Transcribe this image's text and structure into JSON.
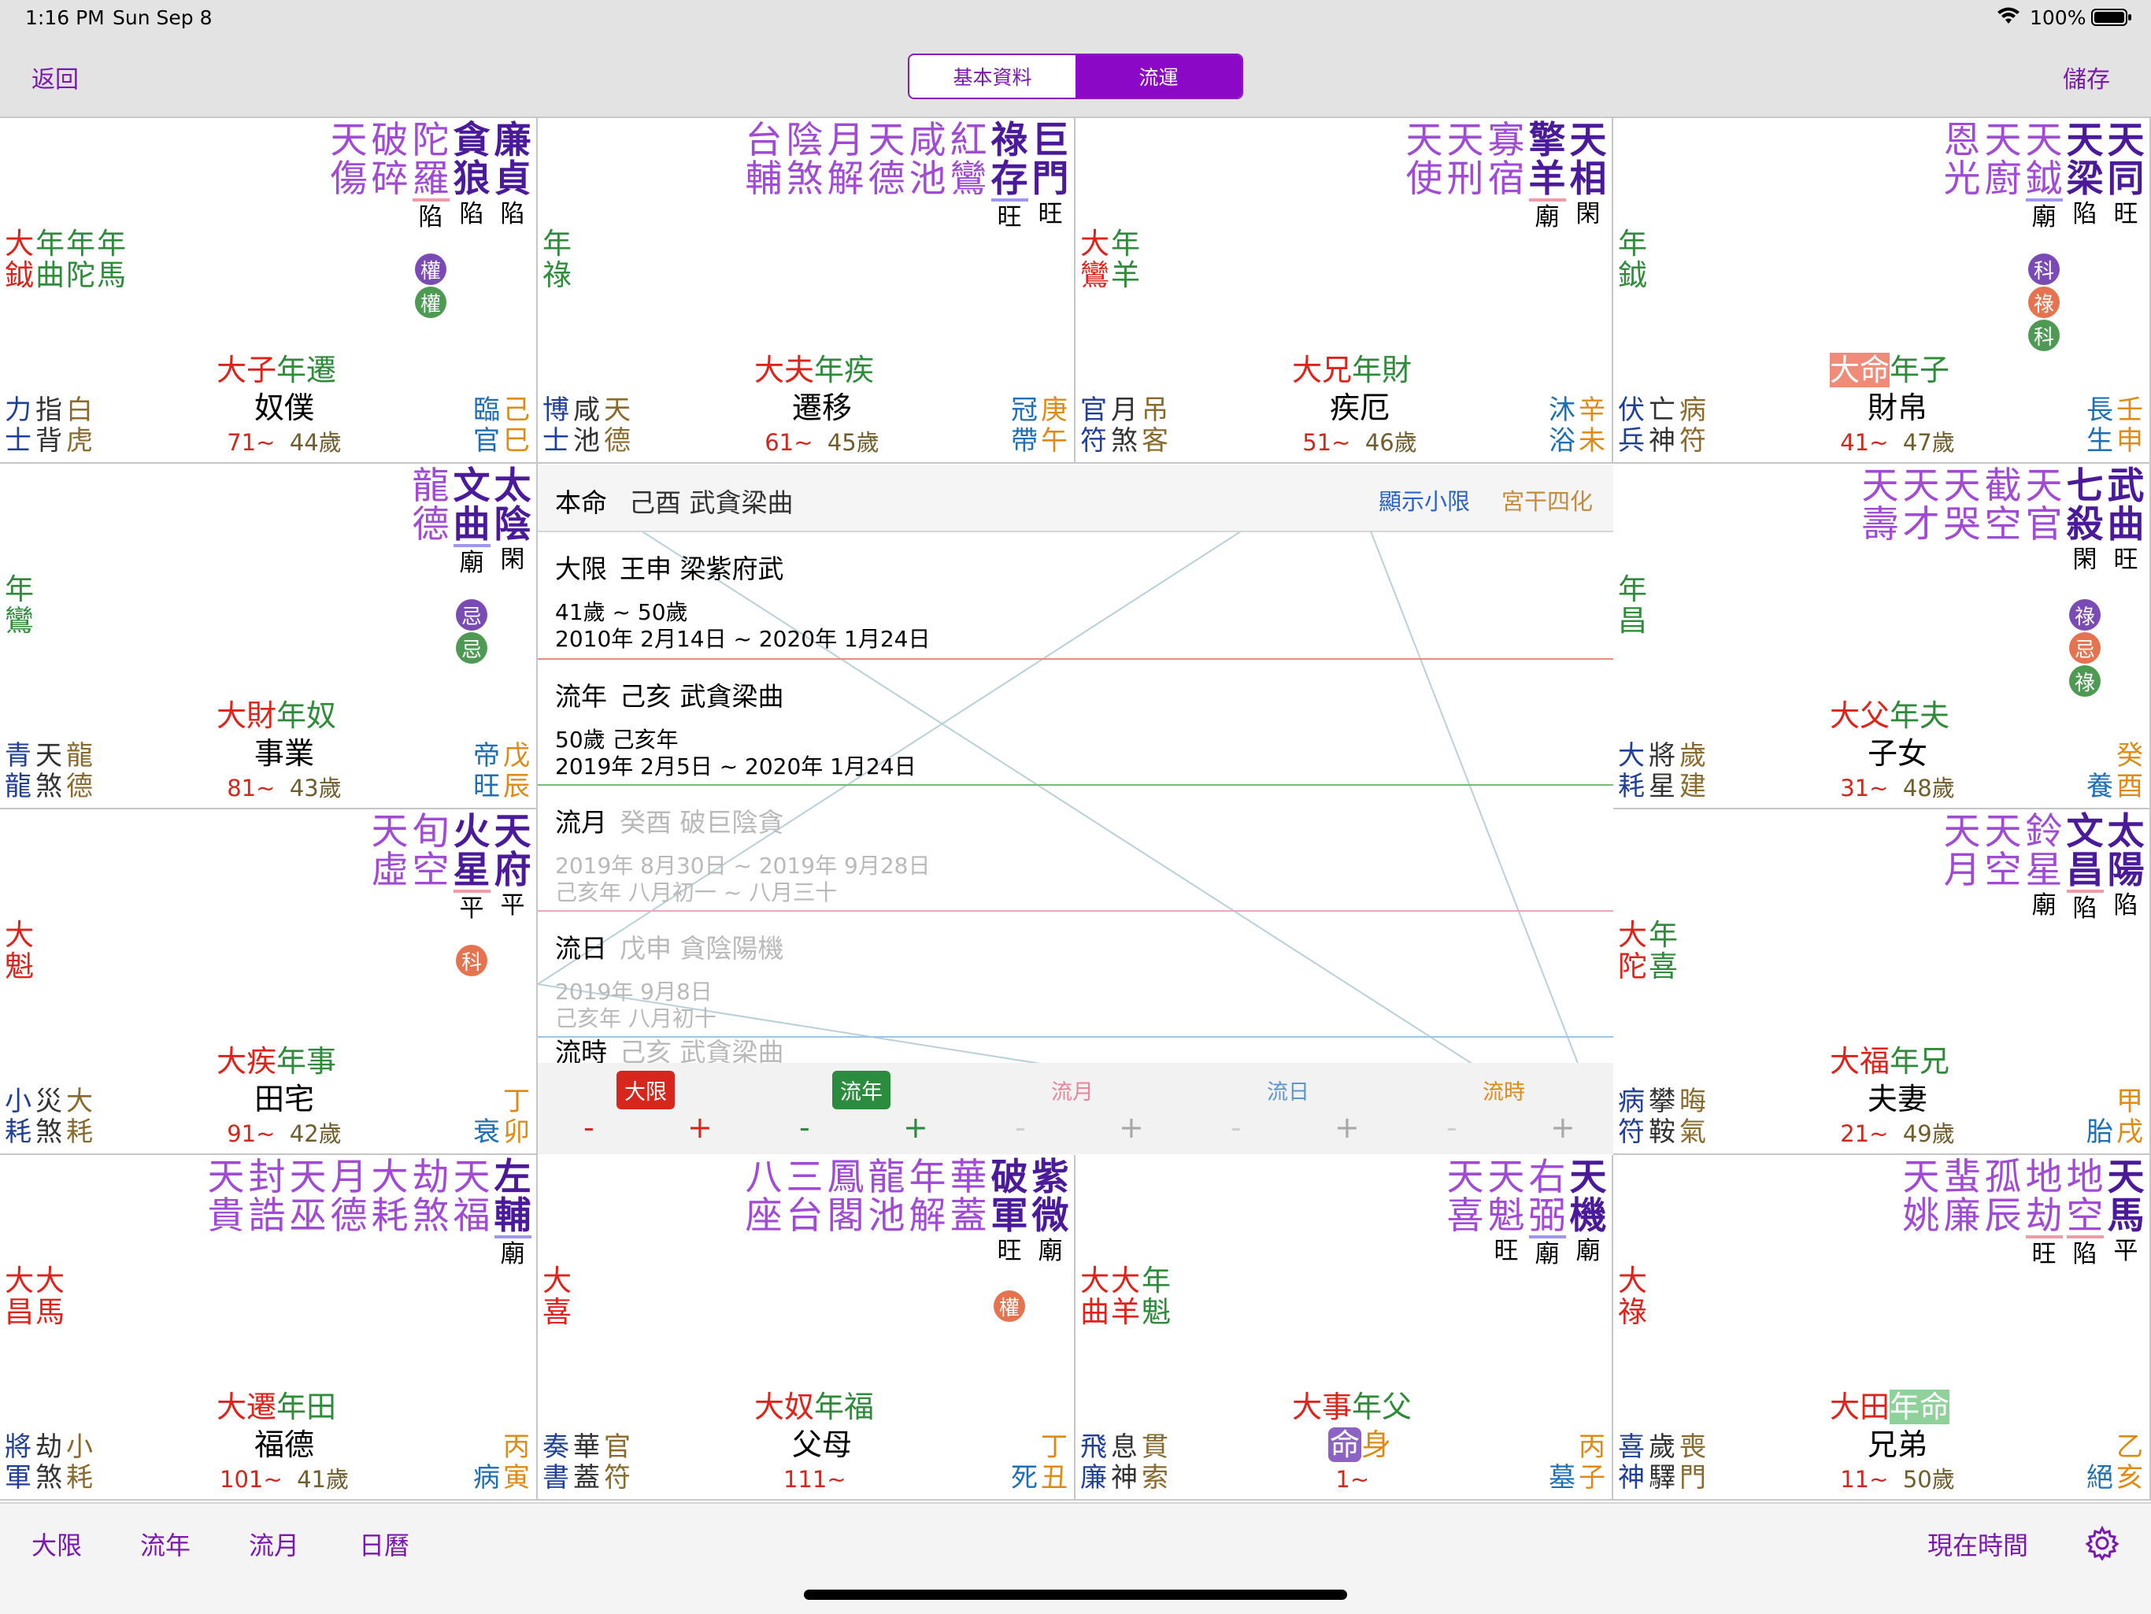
{
  "status_bar": {
    "time": "1:16 PM",
    "date": "Sun Sep 8",
    "battery": "100%",
    "wifi_icon": "wifi-icon"
  },
  "nav": {
    "back": "返回",
    "seg_basic": "基本資料",
    "seg_flow": "流運",
    "save": "儲存"
  },
  "colors": {
    "accent": "#8a08c6",
    "main_star": "#4a1a9a",
    "minor_star": "#a14ad6",
    "red": "#e0231a",
    "green": "#2e8b3a",
    "orange": "#e08a16",
    "blue": "#1f3f9a",
    "brown": "#8a6a2c"
  },
  "cells": [
    {
      "stars_main": [
        [
          "廉",
          "貞"
        ],
        [
          "貪",
          "狼"
        ]
      ],
      "stars_minor": [
        [
          "陀",
          "羅"
        ],
        [
          "破",
          "碎"
        ],
        [
          "天",
          "傷"
        ]
      ],
      "brightness": [
        "陷",
        "陷",
        "陷"
      ],
      "hua": [
        {
          "t": "權",
          "c": "#7b4bb5"
        },
        {
          "t": "權",
          "c": "#4e9a54"
        }
      ],
      "left_cols": [
        [
          "大",
          "鉞"
        ],
        [
          "年",
          "曲"
        ],
        [
          "年",
          "陀"
        ],
        [
          "年",
          "馬"
        ]
      ],
      "p_lab": [
        "大",
        "子",
        "年",
        "遷"
      ],
      "palace": "奴僕",
      "age1": "71~",
      "age2": "44歲",
      "gods": [
        [
          "力",
          "士"
        ],
        [
          "指",
          "背"
        ],
        [
          "白",
          "虎"
        ]
      ],
      "stem": [
        "己",
        "巳"
      ],
      "life": [
        "臨",
        "官"
      ]
    },
    {
      "stars_main": [
        [
          "巨",
          "門"
        ],
        [
          "祿",
          "存"
        ]
      ],
      "stars_minor": [
        [
          "紅",
          "鸞"
        ],
        [
          "咸",
          "池"
        ],
        [
          "天",
          "德"
        ],
        [
          "月",
          "解"
        ],
        [
          "陰",
          "煞"
        ],
        [
          "台",
          "輔"
        ]
      ],
      "brightness": [
        "旺",
        "旺"
      ],
      "hua": [],
      "left_cols": [
        [
          "年",
          "祿"
        ]
      ],
      "p_lab": [
        "大",
        "夫",
        "年",
        "疾"
      ],
      "palace": "遷移",
      "age1": "61~",
      "age2": "45歲",
      "gods": [
        [
          "博",
          "士"
        ],
        [
          "咸",
          "池"
        ],
        [
          "天",
          "德"
        ]
      ],
      "stem": [
        "庚",
        "午"
      ],
      "life": [
        "冠",
        "帶"
      ]
    },
    {
      "stars_main": [
        [
          "天",
          "相"
        ],
        [
          "擎",
          "羊"
        ]
      ],
      "stars_minor": [
        [
          "寡",
          "宿"
        ],
        [
          "天",
          "刑"
        ],
        [
          "天",
          "使"
        ]
      ],
      "brightness": [
        "閑",
        "廟"
      ],
      "hua": [],
      "left_cols": [
        [
          "大",
          "鸞"
        ],
        [
          "年",
          "羊"
        ]
      ],
      "p_lab": [
        "大",
        "兄",
        "年",
        "財"
      ],
      "palace": "疾厄",
      "age1": "51~",
      "age2": "46歲",
      "gods": [
        [
          "官",
          "符"
        ],
        [
          "月",
          "煞"
        ],
        [
          "吊",
          "客"
        ]
      ],
      "stem": [
        "辛",
        "未"
      ],
      "life": [
        "沐",
        "浴"
      ]
    },
    {
      "stars_main": [
        [
          "天",
          "同"
        ],
        [
          "天",
          "梁"
        ]
      ],
      "stars_minor": [
        [
          "天",
          "鉞"
        ],
        [
          "天",
          "廚"
        ],
        [
          "恩",
          "光"
        ]
      ],
      "brightness": [
        "旺",
        "陷",
        "廟"
      ],
      "hua": [
        {
          "t": "科",
          "c": "#7b4bb5"
        },
        {
          "t": "祿",
          "c": "#e5734f"
        },
        {
          "t": "科",
          "c": "#4e9a54"
        }
      ],
      "left_cols": [
        [
          "年",
          "鉞"
        ]
      ],
      "p_lab": [
        "大",
        "命",
        "年",
        "子"
      ],
      "palace": "財帛",
      "age1": "41~",
      "age2": "47歲",
      "gods": [
        [
          "伏",
          "兵"
        ],
        [
          "亡",
          "神"
        ],
        [
          "病",
          "符"
        ]
      ],
      "stem": [
        "壬",
        "申"
      ],
      "life": [
        "長",
        "生"
      ]
    },
    {
      "stars_main": [
        [
          "太",
          "陰"
        ],
        [
          "文",
          "曲"
        ]
      ],
      "stars_minor": [
        [
          "龍",
          "德"
        ]
      ],
      "brightness": [
        "閑",
        "廟"
      ],
      "hua": [
        {
          "t": "忌",
          "c": "#7b4bb5"
        },
        {
          "t": "忌",
          "c": "#4e9a54"
        }
      ],
      "left_cols": [
        [
          "年",
          "鸞"
        ]
      ],
      "p_lab": [
        "大",
        "財",
        "年",
        "奴"
      ],
      "palace": "事業",
      "age1": "81~",
      "age2": "43歲",
      "gods": [
        [
          "青",
          "龍"
        ],
        [
          "天",
          "煞"
        ],
        [
          "龍",
          "德"
        ]
      ],
      "stem": [
        "戊",
        "辰"
      ],
      "life": [
        "帝",
        "旺"
      ]
    },
    {
      "stars_main": [
        [
          "武",
          "曲"
        ],
        [
          "七",
          "殺"
        ]
      ],
      "stars_minor": [
        [
          "天",
          "官"
        ],
        [
          "截",
          "空"
        ],
        [
          "天",
          "哭"
        ],
        [
          "天",
          "才"
        ],
        [
          "天",
          "壽"
        ]
      ],
      "brightness": [
        "旺",
        "閑"
      ],
      "hua": [
        {
          "t": "祿",
          "c": "#7b4bb5"
        },
        {
          "t": "忌",
          "c": "#e5734f"
        },
        {
          "t": "祿",
          "c": "#4e9a54"
        }
      ],
      "left_cols": [
        [
          "年",
          "昌"
        ]
      ],
      "p_lab": [
        "大",
        "父",
        "年",
        "夫"
      ],
      "palace": "子女",
      "age1": "31~",
      "age2": "48歲",
      "gods": [
        [
          "大",
          "耗"
        ],
        [
          "將",
          "星"
        ],
        [
          "歲",
          "建"
        ]
      ],
      "stem": [
        "癸",
        "酉"
      ],
      "life": [
        "養"
      ]
    },
    {
      "stars_main": [
        [
          "天",
          "府"
        ],
        [
          "火",
          "星"
        ]
      ],
      "stars_minor": [
        [
          "旬",
          "空"
        ],
        [
          "天",
          "虛"
        ]
      ],
      "brightness": [
        "平",
        "平"
      ],
      "hua": [
        {
          "t": "科",
          "c": "#e5734f"
        }
      ],
      "left_cols": [
        [
          "大",
          "魁"
        ]
      ],
      "p_lab": [
        "大",
        "疾",
        "年",
        "事"
      ],
      "palace": "田宅",
      "age1": "91~",
      "age2": "42歲",
      "gods": [
        [
          "小",
          "耗"
        ],
        [
          "災",
          "煞"
        ],
        [
          "大",
          "耗"
        ]
      ],
      "stem": [
        "丁",
        "卯"
      ],
      "life": [
        "衰"
      ]
    },
    {
      "stars_main": [
        [
          "太",
          "陽"
        ],
        [
          "文",
          "昌"
        ]
      ],
      "stars_minor": [
        [
          "鈴",
          "星"
        ],
        [
          "天",
          "空"
        ],
        [
          "天",
          "月"
        ]
      ],
      "brightness": [
        "陷",
        "陷",
        "廟"
      ],
      "hua": [],
      "left_cols": [
        [
          "大",
          "陀"
        ],
        [
          "年",
          "喜"
        ]
      ],
      "p_lab": [
        "大",
        "福",
        "年",
        "兄"
      ],
      "palace": "夫妻",
      "age1": "21~",
      "age2": "49歲",
      "gods": [
        [
          "病",
          "符"
        ],
        [
          "攀",
          "鞍"
        ],
        [
          "晦",
          "氣"
        ]
      ],
      "stem": [
        "甲",
        "戌"
      ],
      "life": [
        "胎"
      ]
    },
    {
      "stars_main": [
        [
          "左",
          "輔"
        ]
      ],
      "stars_minor": [
        [
          "天",
          "福"
        ],
        [
          "劫",
          "煞"
        ],
        [
          "大",
          "耗"
        ],
        [
          "月",
          "德"
        ],
        [
          "天",
          "巫"
        ],
        [
          "封",
          "誥"
        ],
        [
          "天",
          "貴"
        ]
      ],
      "brightness": [
        "廟"
      ],
      "hua": [],
      "left_cols": [
        [
          "大",
          "昌"
        ],
        [
          "大",
          "馬"
        ]
      ],
      "p_lab": [
        "大",
        "遷",
        "年",
        "田"
      ],
      "palace": "福德",
      "age1": "101~",
      "age2": "41歲",
      "gods": [
        [
          "將",
          "軍"
        ],
        [
          "劫",
          "煞"
        ],
        [
          "小",
          "耗"
        ]
      ],
      "stem": [
        "丙",
        "寅"
      ],
      "life": [
        "病"
      ]
    },
    {
      "stars_main": [
        [
          "紫",
          "微"
        ],
        [
          "破",
          "軍"
        ]
      ],
      "stars_minor": [
        [
          "華",
          "蓋"
        ],
        [
          "年",
          "解"
        ],
        [
          "龍",
          "池"
        ],
        [
          "鳳",
          "閣"
        ],
        [
          "三",
          "台"
        ],
        [
          "八",
          "座"
        ]
      ],
      "brightness": [
        "廟",
        "旺"
      ],
      "hua": [
        {
          "t": "權",
          "c": "#e5734f"
        }
      ],
      "left_cols": [
        [
          "大",
          "喜"
        ]
      ],
      "p_lab": [
        "大",
        "奴",
        "年",
        "福"
      ],
      "palace": "父母",
      "age1": "111~",
      "age2": "",
      "gods": [
        [
          "奏",
          "書"
        ],
        [
          "華",
          "蓋"
        ],
        [
          "官",
          "符"
        ]
      ],
      "stem": [
        "丁",
        "丑"
      ],
      "life": [
        "死"
      ]
    },
    {
      "stars_main": [
        [
          "天",
          "機"
        ]
      ],
      "stars_minor": [
        [
          "右",
          "弼"
        ],
        [
          "天",
          "魁"
        ],
        [
          "天",
          "喜"
        ]
      ],
      "brightness": [
        "廟",
        "廟",
        "旺"
      ],
      "hua": [],
      "left_cols": [
        [
          "大",
          "曲"
        ],
        [
          "大",
          "羊"
        ],
        [
          "年",
          "魁"
        ]
      ],
      "p_lab": [
        "大",
        "事",
        "年",
        "父"
      ],
      "palace": "身",
      "palace_prefix": "命",
      "age1": "1~",
      "age2": "",
      "gods": [
        [
          "飛",
          "廉"
        ],
        [
          "息",
          "神"
        ],
        [
          "貫",
          "索"
        ]
      ],
      "stem": [
        "丙",
        "子"
      ],
      "life": [
        "墓"
      ]
    },
    {
      "stars_main": [
        [
          "天",
          "馬"
        ]
      ],
      "stars_minor": [
        [
          "地",
          "空"
        ],
        [
          "地",
          "劫"
        ],
        [
          "孤",
          "辰"
        ],
        [
          "蜚",
          "廉"
        ],
        [
          "天",
          "姚"
        ]
      ],
      "brightness": [
        "平",
        "陷",
        "旺"
      ],
      "hua": [],
      "left_cols": [
        [
          "大",
          "祿"
        ]
      ],
      "p_lab": [
        "大",
        "田",
        "年",
        "命"
      ],
      "palace": "兄弟",
      "age1": "11~",
      "age2": "50歲",
      "gods": [
        [
          "喜",
          "神"
        ],
        [
          "歲",
          "驛"
        ],
        [
          "喪",
          "門"
        ]
      ],
      "stem": [
        "乙",
        "亥"
      ],
      "life": [
        "絕"
      ]
    }
  ],
  "center": {
    "natal": {
      "label": "本命",
      "text": "己酉 武貪梁曲",
      "link1": "顯示小限",
      "link2": "宮干四化"
    },
    "decade": {
      "label": "大限",
      "text": "王申 梁紫府武",
      "line1": "41歲 ~ 50歲",
      "line2": "2010年 2月14日 ~ 2020年 1月24日"
    },
    "year": {
      "label": "流年",
      "text": "己亥 武貪梁曲",
      "line1": "50歲 己亥年",
      "line2": "2019年 2月5日 ~ 2020年 1月24日"
    },
    "month": {
      "label": "流月",
      "text": "癸酉 破巨陰貪",
      "line1": "2019年 8月30日 ~ 2019年 9月28日",
      "line2": "己亥年 八月初一 ~ 八月三十"
    },
    "day": {
      "label": "流日",
      "text": "戊申 貪陰陽機",
      "line1": "2019年 9月8日",
      "line2": "己亥年 八月初十"
    },
    "hour": {
      "label": "流時",
      "text": "己亥 武貪梁曲"
    },
    "buttons": [
      "大限",
      "流年",
      "流月",
      "流日",
      "流時"
    ],
    "minus": "-",
    "plus": "+"
  },
  "tabs": {
    "t1": "大限",
    "t2": "流年",
    "t3": "流月",
    "t4": "日曆",
    "now": "現在時間",
    "settings_icon": "gear-icon"
  }
}
